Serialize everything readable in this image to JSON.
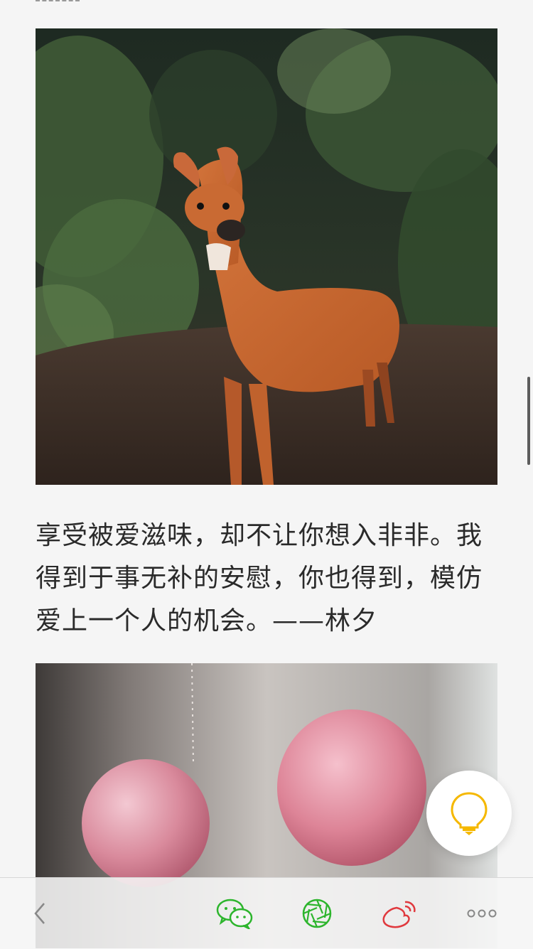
{
  "article": {
    "caption": "享受被爱滋味，却不让你想入非非。我得到于事无补的安慰，你也得到，模仿爱上一个人的机会。——林夕"
  },
  "images": {
    "first": "deer-in-forest-photo",
    "second": "pink-balloons-photo"
  },
  "fab": {
    "icon": "lightbulb-icon",
    "color": "#f5b800"
  },
  "bottom_bar": {
    "items": [
      {
        "name": "back",
        "icon": "chevron-left-icon"
      },
      {
        "name": "wechat",
        "icon": "wechat-icon",
        "color": "#2db52d"
      },
      {
        "name": "moments",
        "icon": "moments-aperture-icon",
        "color": "#2db52d"
      },
      {
        "name": "weibo",
        "icon": "weibo-icon",
        "color": "#e0393e"
      },
      {
        "name": "more",
        "icon": "more-dots-icon"
      }
    ]
  }
}
